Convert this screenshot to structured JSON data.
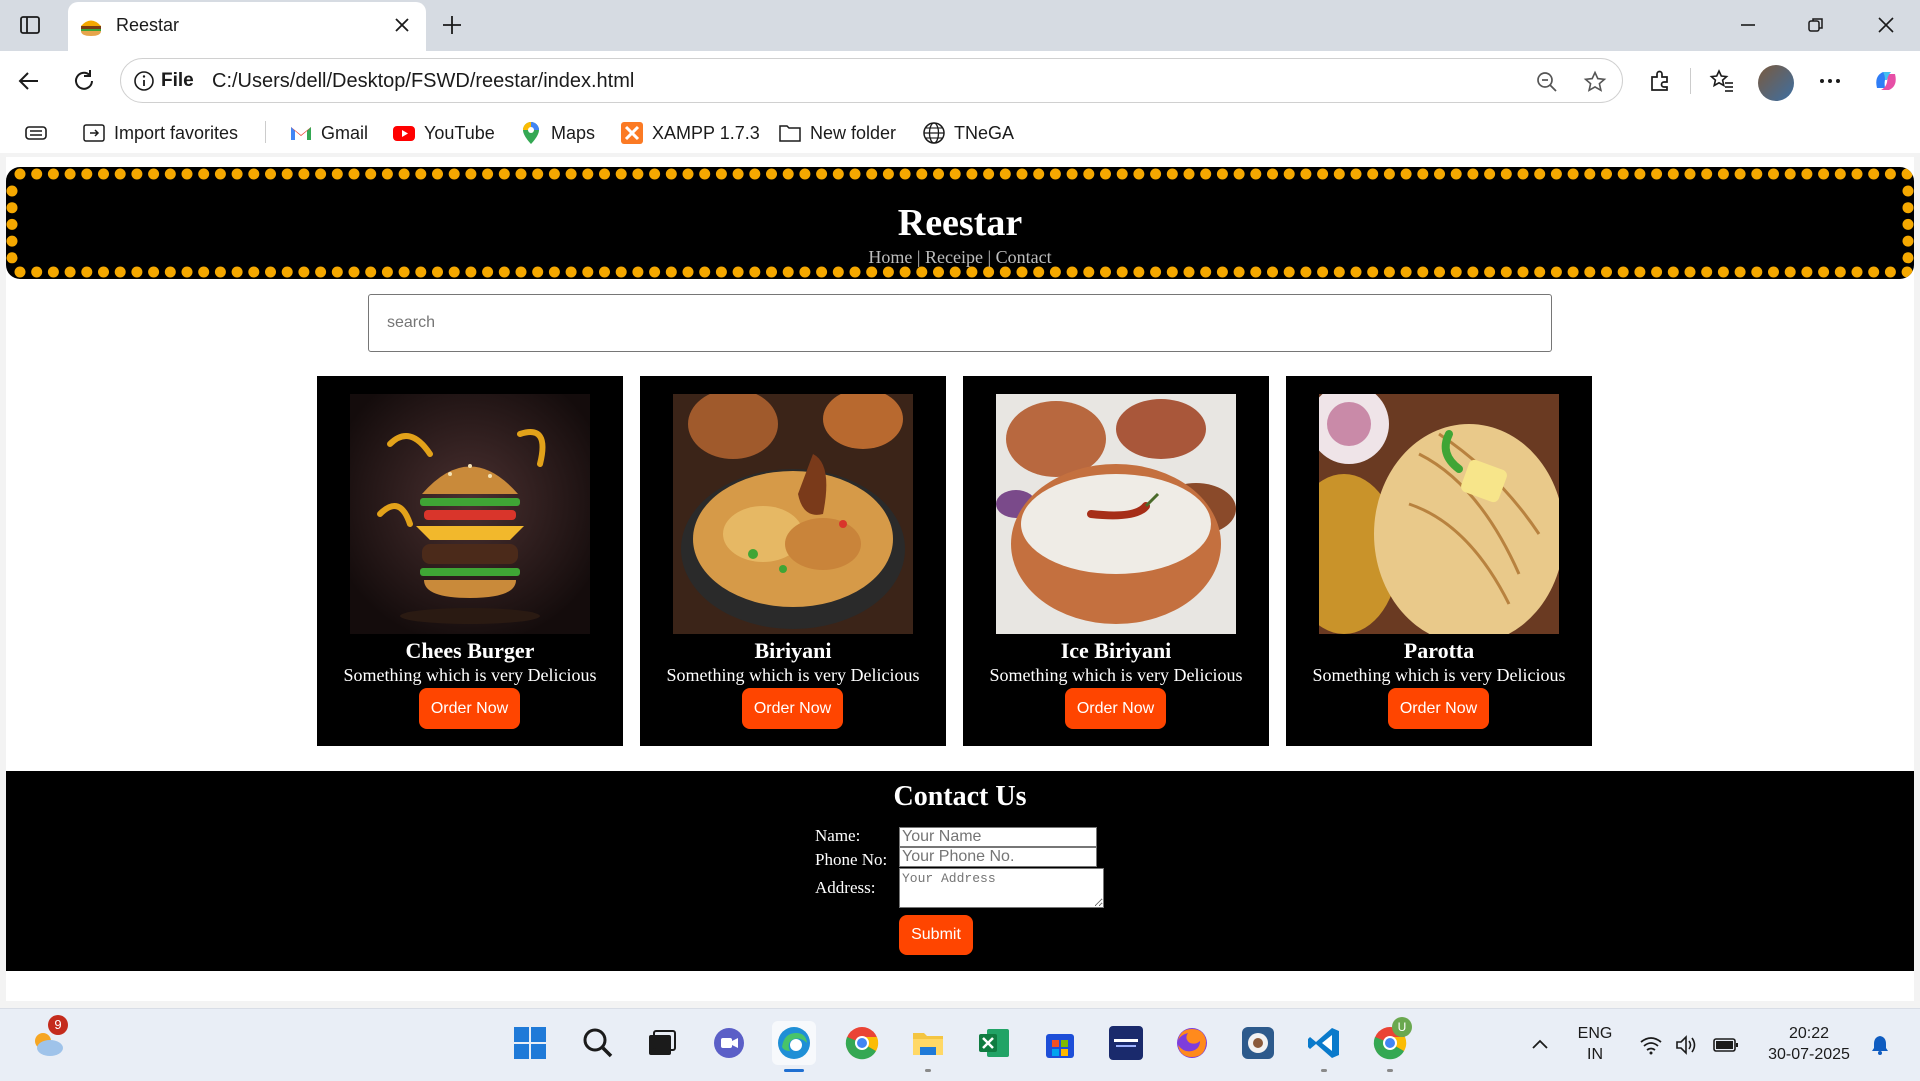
{
  "browser": {
    "tab_title": "Reestar",
    "address_scheme": "File",
    "address_url": "C:/Users/dell/Desktop/FSWD/reestar/index.html",
    "bookmarks": [
      {
        "label": "Import favorites",
        "icon": "import-icon"
      },
      {
        "label": "Gmail",
        "icon": "gmail-icon"
      },
      {
        "label": "YouTube",
        "icon": "youtube-icon"
      },
      {
        "label": "Maps",
        "icon": "maps-icon"
      },
      {
        "label": "XAMPP 1.7.3",
        "icon": "xampp-icon"
      },
      {
        "label": "New folder",
        "icon": "folder-icon"
      },
      {
        "label": "TNeGA",
        "icon": "globe-icon"
      }
    ]
  },
  "page": {
    "site_title": "Reestar",
    "nav": {
      "home": "Home",
      "sep1": " | ",
      "recipe": "Receipe",
      "sep2": " | ",
      "contact": "Contact"
    },
    "search_placeholder": "search",
    "cards": [
      {
        "name": "Chees Burger",
        "desc": "Something which is very Delicious",
        "button": "Order Now",
        "image": "burger-image"
      },
      {
        "name": "Biriyani",
        "desc": "Something which is very Delicious",
        "button": "Order Now",
        "image": "biriyani-image"
      },
      {
        "name": "Ice Biriyani",
        "desc": "Something which is very Delicious",
        "button": "Order Now",
        "image": "ice-biriyani-image"
      },
      {
        "name": "Parotta",
        "desc": "Something which is very Delicious",
        "button": "Order Now",
        "image": "parotta-image"
      }
    ],
    "contact": {
      "heading": "Contact Us",
      "name_label": "Name:",
      "name_placeholder": "Your Name",
      "phone_label": "Phone No:",
      "phone_placeholder": "Your Phone No.",
      "address_label": "Address:",
      "address_placeholder": "Your Address",
      "submit": "Submit"
    }
  },
  "taskbar": {
    "weather_badge": "9",
    "lang_top": "ENG",
    "lang_bottom": "IN",
    "time": "20:22",
    "date": "30-07-2025",
    "chrome_badge": "U"
  },
  "colors": {
    "accent": "#ff4500",
    "header_dots": "#f5a800",
    "page_black": "#000000"
  }
}
